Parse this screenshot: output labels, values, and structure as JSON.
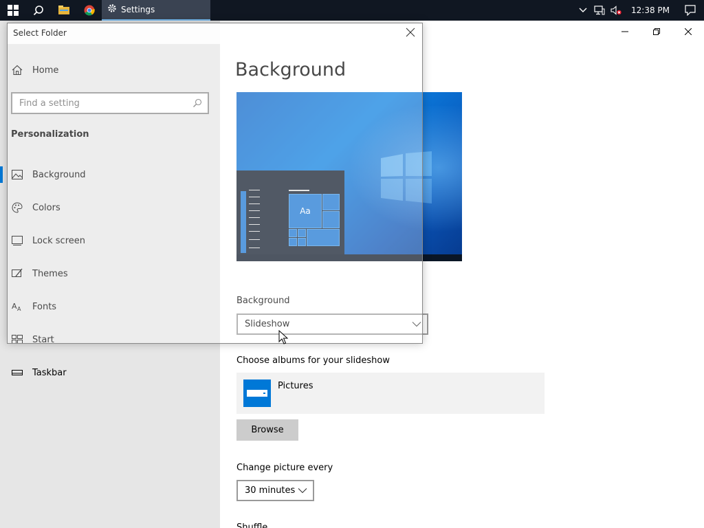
{
  "taskbar": {
    "active_app_label": "Settings",
    "clock": "12:38 PM",
    "icons": [
      "windows-start-icon",
      "search-icon",
      "file-explorer-icon",
      "chrome-icon",
      "gear-icon",
      "chevron-up-icon",
      "network-icon",
      "volume-muted-icon",
      "action-center-icon"
    ]
  },
  "dialog": {
    "title": "Select Folder"
  },
  "sidebar": {
    "home_label": "Home",
    "search_placeholder": "Find a setting",
    "section_title": "Personalization",
    "items": [
      {
        "label": "Background",
        "icon": "picture-icon",
        "active": true
      },
      {
        "label": "Colors",
        "icon": "palette-icon"
      },
      {
        "label": "Lock screen",
        "icon": "lock-screen-icon"
      },
      {
        "label": "Themes",
        "icon": "themes-icon"
      },
      {
        "label": "Fonts",
        "icon": "fonts-icon"
      },
      {
        "label": "Start",
        "icon": "start-icon"
      },
      {
        "label": "Taskbar",
        "icon": "taskbar-icon"
      }
    ]
  },
  "main": {
    "title": "Background",
    "preview_tile_text": "Aa",
    "background_label": "Background",
    "background_value": "Slideshow",
    "albums_label": "Choose albums for your slideshow",
    "album_name": "Pictures",
    "browse_label": "Browse",
    "change_label": "Change picture every",
    "change_value": "30 minutes",
    "shuffle_label": "Shuffle"
  },
  "colors": {
    "accent": "#0078d7",
    "taskbar": "#101722",
    "sidebar_bg": "#e6e6e6"
  }
}
